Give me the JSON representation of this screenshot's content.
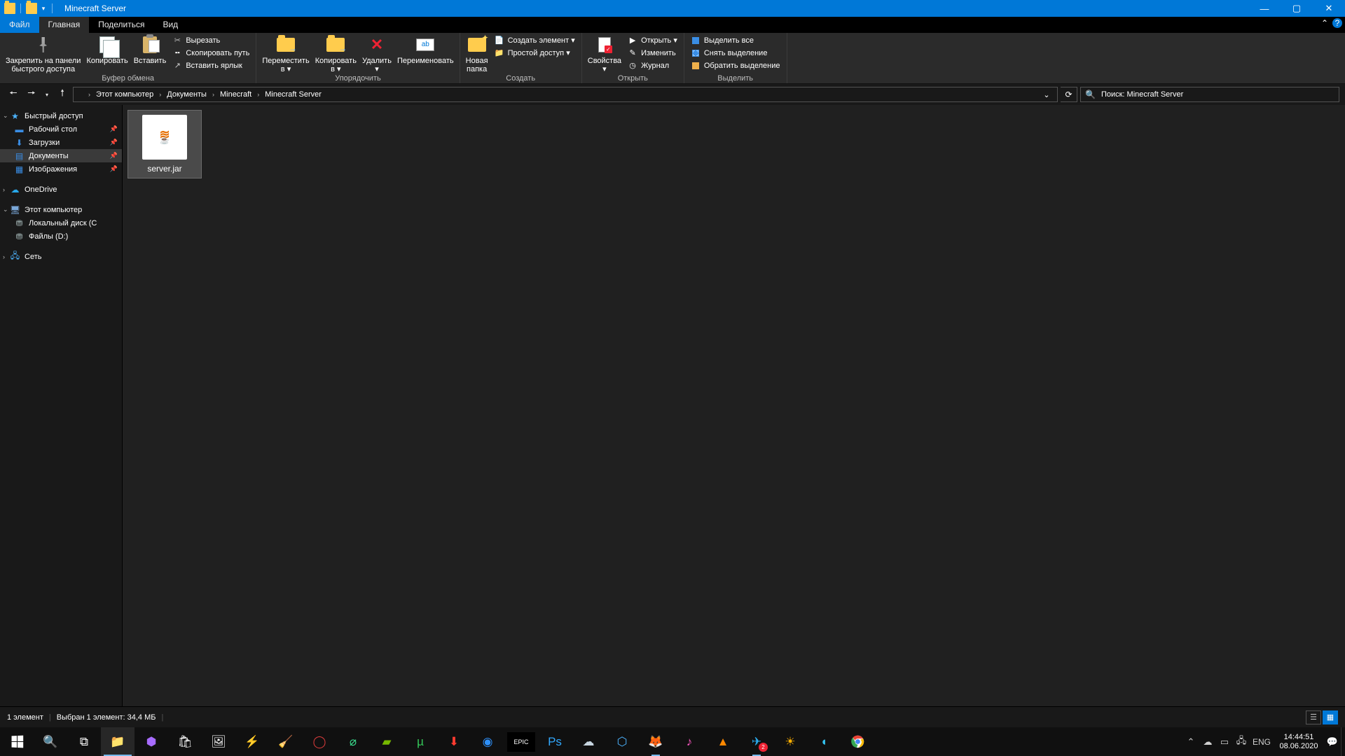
{
  "title": "Minecraft Server",
  "tabs": {
    "file": "Файл",
    "home": "Главная",
    "share": "Поделиться",
    "view": "Вид"
  },
  "ribbon": {
    "pin": "Закрепить на панели\nбыстрого доступа",
    "copy": "Копировать",
    "paste": "Вставить",
    "cut": "Вырезать",
    "copypath": "Скопировать путь",
    "pastelink": "Вставить ярлык",
    "grp_clipboard": "Буфер обмена",
    "moveto": "Переместить\nв ▾",
    "copyto": "Копировать\nв ▾",
    "delete": "Удалить\n▾",
    "rename": "Переименовать",
    "grp_organize": "Упорядочить",
    "newfolder": "Новая\nпапка",
    "newitem": "Создать элемент ▾",
    "easyaccess": "Простой доступ ▾",
    "grp_new": "Создать",
    "props": "Свойства\n▾",
    "open": "Открыть ▾",
    "edit": "Изменить",
    "history": "Журнал",
    "grp_open": "Открыть",
    "selectall": "Выделить все",
    "selectnone": "Снять выделение",
    "invert": "Обратить выделение",
    "grp_select": "Выделить"
  },
  "breadcrumb": [
    "Этот компьютер",
    "Документы",
    "Minecraft",
    "Minecraft Server"
  ],
  "search_placeholder": "Поиск: Minecraft Server",
  "tree": {
    "quick": "Быстрый доступ",
    "desktop": "Рабочий стол",
    "downloads": "Загрузки",
    "documents": "Документы",
    "pictures": "Изображения",
    "onedrive": "OneDrive",
    "thispc": "Этот компьютер",
    "diskC": "Локальный диск (C",
    "diskD": "Файлы (D:)",
    "network": "Сеть"
  },
  "file": {
    "name": "server.jar"
  },
  "status": {
    "count": "1 элемент",
    "selection": "Выбран 1 элемент: 34,4 МБ"
  },
  "taskbar": {
    "telegram_badge": "2",
    "lang": "ENG",
    "time": "14:44:51",
    "date": "08.06.2020"
  }
}
